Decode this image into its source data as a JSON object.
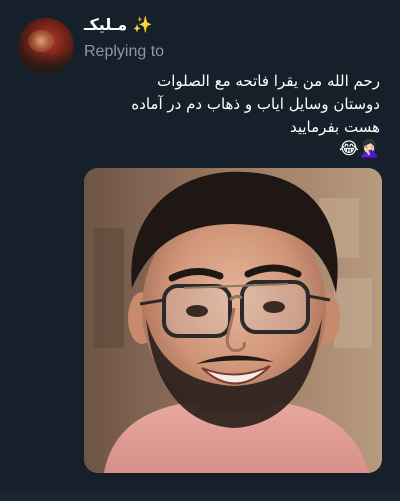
{
  "tweet": {
    "display_name": "مـلیکـ ✨",
    "replying_label": "Replying to",
    "text_lines": [
      "رحم الله من یقرا فاتحه مع الصلوات",
      "دوستان وسایل ایاب و ذهاب دم در آماده",
      "هست بفرمایید"
    ],
    "emojis": "😂🤦🏻‍♀️",
    "avatar_icon": "avatar-icon",
    "media_description_icon": "photo-icon"
  },
  "colors": {
    "background": "#15202b",
    "text_primary": "#ffffff",
    "text_secondary": "#8b98a5"
  }
}
